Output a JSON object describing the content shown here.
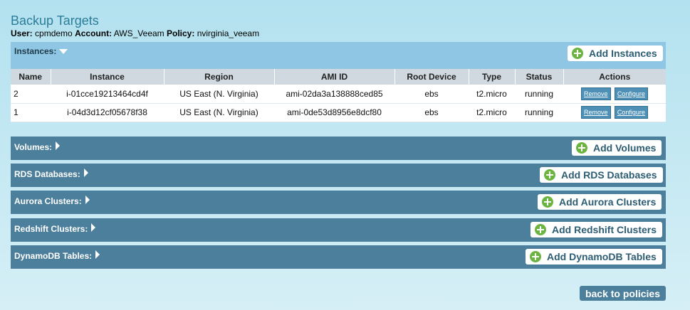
{
  "page": {
    "title": "Backup Targets",
    "user_label": "User:",
    "user_value": "cpmdemo",
    "account_label": "Account:",
    "account_value": "AWS_Veeam",
    "policy_label": "Policy:",
    "policy_value": "nvirginia_veeam"
  },
  "instances": {
    "label": "Instances:",
    "add_label": "Add Instances",
    "columns": [
      "Name",
      "Instance",
      "Region",
      "AMI ID",
      "Root Device",
      "Type",
      "Status",
      "Actions"
    ],
    "rows": [
      {
        "name": "2",
        "instance": "i-01cce19213464cd4f",
        "region": "US East (N. Virginia)",
        "ami": "ami-02da3a138888ced85",
        "root": "ebs",
        "type": "t2.micro",
        "status": "running"
      },
      {
        "name": "1",
        "instance": "i-04d3d12cf05678f38",
        "region": "US East (N. Virginia)",
        "ami": "ami-0de53d8956e8dcf80",
        "root": "ebs",
        "type": "t2.micro",
        "status": "running"
      }
    ],
    "remove_label": "Remove",
    "configure_label": "Configure"
  },
  "sections": [
    {
      "label": "Volumes:",
      "add_label": "Add Volumes"
    },
    {
      "label": "RDS Databases:",
      "add_label": "Add RDS Databases"
    },
    {
      "label": "Aurora Clusters:",
      "add_label": "Add Aurora Clusters"
    },
    {
      "label": "Redshift Clusters:",
      "add_label": "Add Redshift Clusters"
    },
    {
      "label": "DynamoDB Tables:",
      "add_label": "Add DynamoDB Tables"
    }
  ],
  "back_label": "back to policies",
  "colors": {
    "title": "#2b7d9a",
    "panel_dark": "#4b7f9b",
    "panel_light": "#8fc6e4",
    "plus_green": "#6bb43f",
    "mini_button": "#4d8fb5"
  }
}
